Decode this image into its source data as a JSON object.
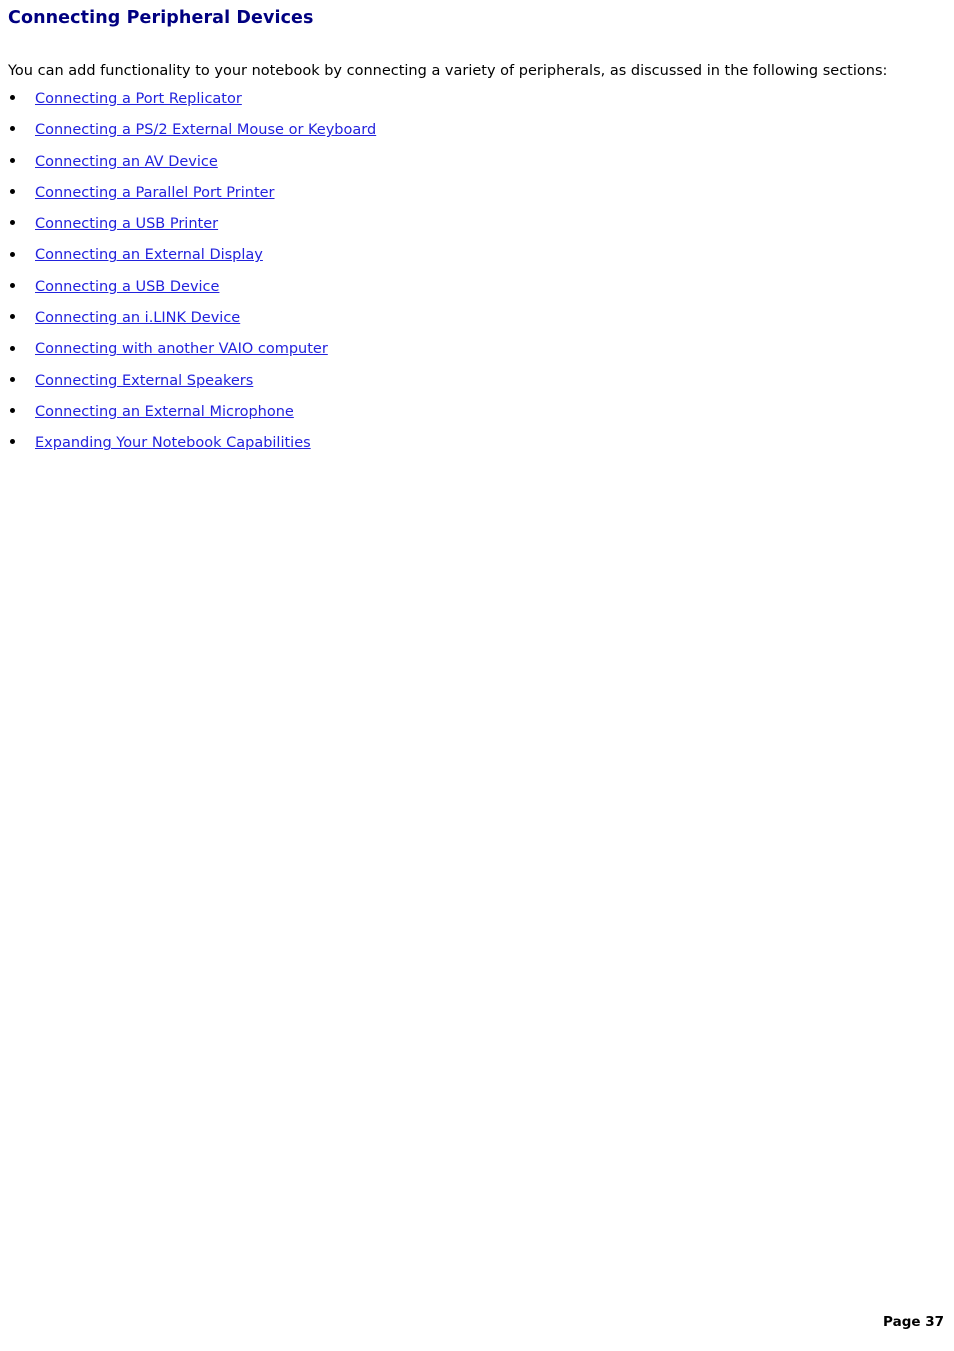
{
  "document": {
    "heading": "Connecting Peripheral Devices",
    "intro": "You can add functionality to your notebook by connecting a variety of peripherals, as discussed in the following sections:",
    "links": [
      {
        "label": "Connecting a Port Replicator"
      },
      {
        "label": "Connecting a PS/2 External Mouse or Keyboard"
      },
      {
        "label": "Connecting an AV Device"
      },
      {
        "label": "Connecting a Parallel Port Printer"
      },
      {
        "label": "Connecting a USB Printer"
      },
      {
        "label": "Connecting an External Display"
      },
      {
        "label": "Connecting a USB Device"
      },
      {
        "label": "Connecting an i.LINK Device"
      },
      {
        "label": "Connecting with another VAIO computer"
      },
      {
        "label": "Connecting External Speakers"
      },
      {
        "label": "Connecting an External Microphone"
      },
      {
        "label": "Expanding Your Notebook Capabilities"
      }
    ],
    "footer": "Page 37",
    "colors": {
      "heading": "#000080",
      "link": "#2222dd",
      "text": "#000000",
      "background": "#ffffff"
    }
  }
}
